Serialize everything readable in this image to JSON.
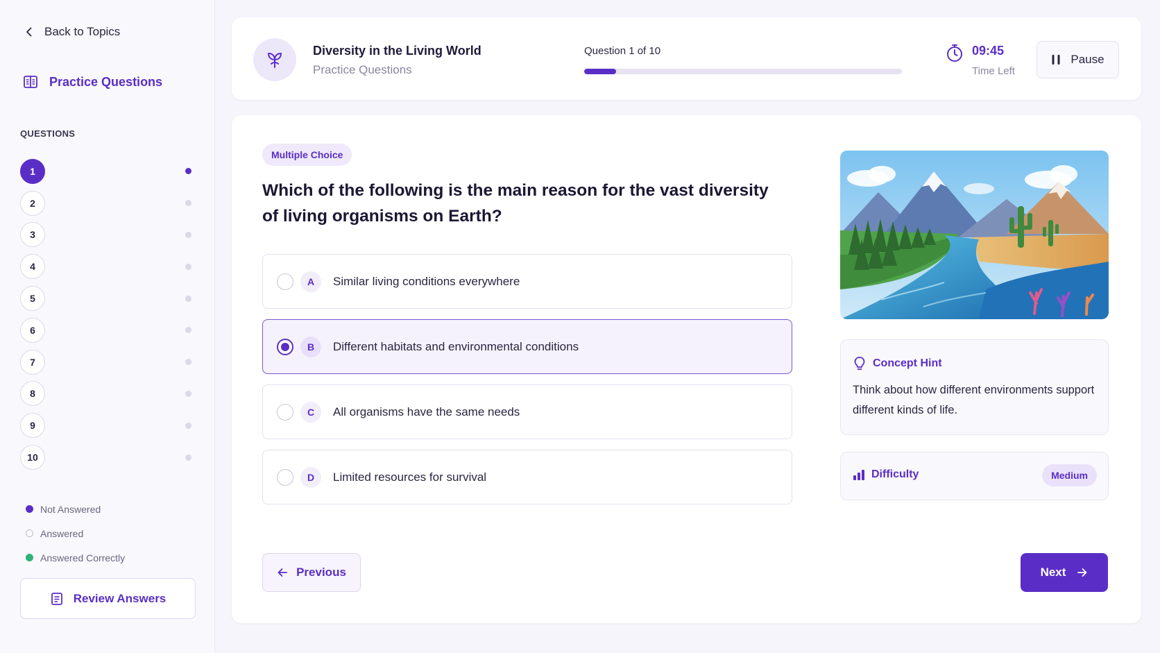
{
  "sidebar": {
    "back_label": "Back to Topics",
    "title": "Practice Questions",
    "questions_heading": "QUESTIONS",
    "questions": [
      "1",
      "2",
      "3",
      "4",
      "5",
      "6",
      "7",
      "8",
      "9",
      "10"
    ],
    "active_question": "1",
    "legend": {
      "not_answered": "Not Answered",
      "answered": "Answered",
      "answered_correctly": "Answered Correctly"
    },
    "review_label": "Review Answers"
  },
  "header": {
    "topic_title": "Diversity in the Living World",
    "topic_subtitle": "Practice Questions",
    "progress_label": "Question 1 of 10",
    "progress_fraction": 0.1,
    "timer_value": "09:45",
    "timer_label": "Time Left",
    "pause_label": "Pause"
  },
  "question": {
    "type_badge": "Multiple Choice",
    "text": "Which of the following is the main reason for the vast diversity of living organisms on Earth?",
    "options": [
      {
        "letter": "A",
        "text": "Similar living conditions everywhere",
        "selected": false
      },
      {
        "letter": "B",
        "text": "Different habitats and environmental conditions",
        "selected": true
      },
      {
        "letter": "C",
        "text": "All organisms have the same needs",
        "selected": false
      },
      {
        "letter": "D",
        "text": "Limited resources for survival",
        "selected": false
      }
    ],
    "previous_label": "Previous",
    "next_label": "Next"
  },
  "hint": {
    "title": "Concept Hint",
    "body": "Think about how different environments support different kinds of life."
  },
  "difficulty": {
    "title": "Difficulty",
    "level": "Medium"
  },
  "colors": {
    "accent": "#5a2ec6",
    "accent_light": "#efe9fb",
    "success": "#2fb37a",
    "background": "#f6f5fb"
  },
  "icons": {
    "back": "chevron-left-icon",
    "practice": "book-open-icon",
    "topic": "sprout-icon",
    "timer": "stopwatch-icon",
    "pause": "pause-icon",
    "hint": "lightbulb-icon",
    "difficulty": "bar-chart-icon",
    "review": "document-icon",
    "previous": "arrow-left-icon",
    "next": "arrow-right-icon"
  }
}
